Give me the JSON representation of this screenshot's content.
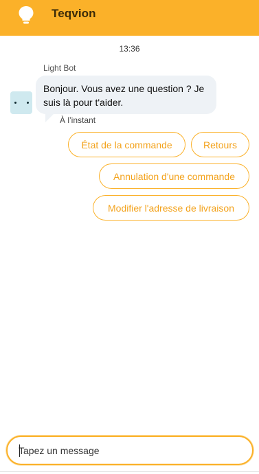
{
  "header": {
    "title": "Teqvion",
    "logo_icon": "lightbulb-icon",
    "background": "#fbb129"
  },
  "chat": {
    "timestamp": "13:36",
    "sender": "Light Bot",
    "message": "Bonjour. Vous avez une question ? Je suis là pour t'aider.",
    "message_time": "À l’instant"
  },
  "quick_replies": [
    {
      "label": "État de la commande"
    },
    {
      "label": "Retours"
    },
    {
      "label": "Annulation d'une commande"
    },
    {
      "label": "Modifier l'adresse de livraison"
    }
  ],
  "composer": {
    "placeholder": "Tapez un message",
    "value": ""
  },
  "colors": {
    "accent": "#fbb129",
    "bubble": "#eef2f6",
    "avatar": "#cfe9ef"
  }
}
